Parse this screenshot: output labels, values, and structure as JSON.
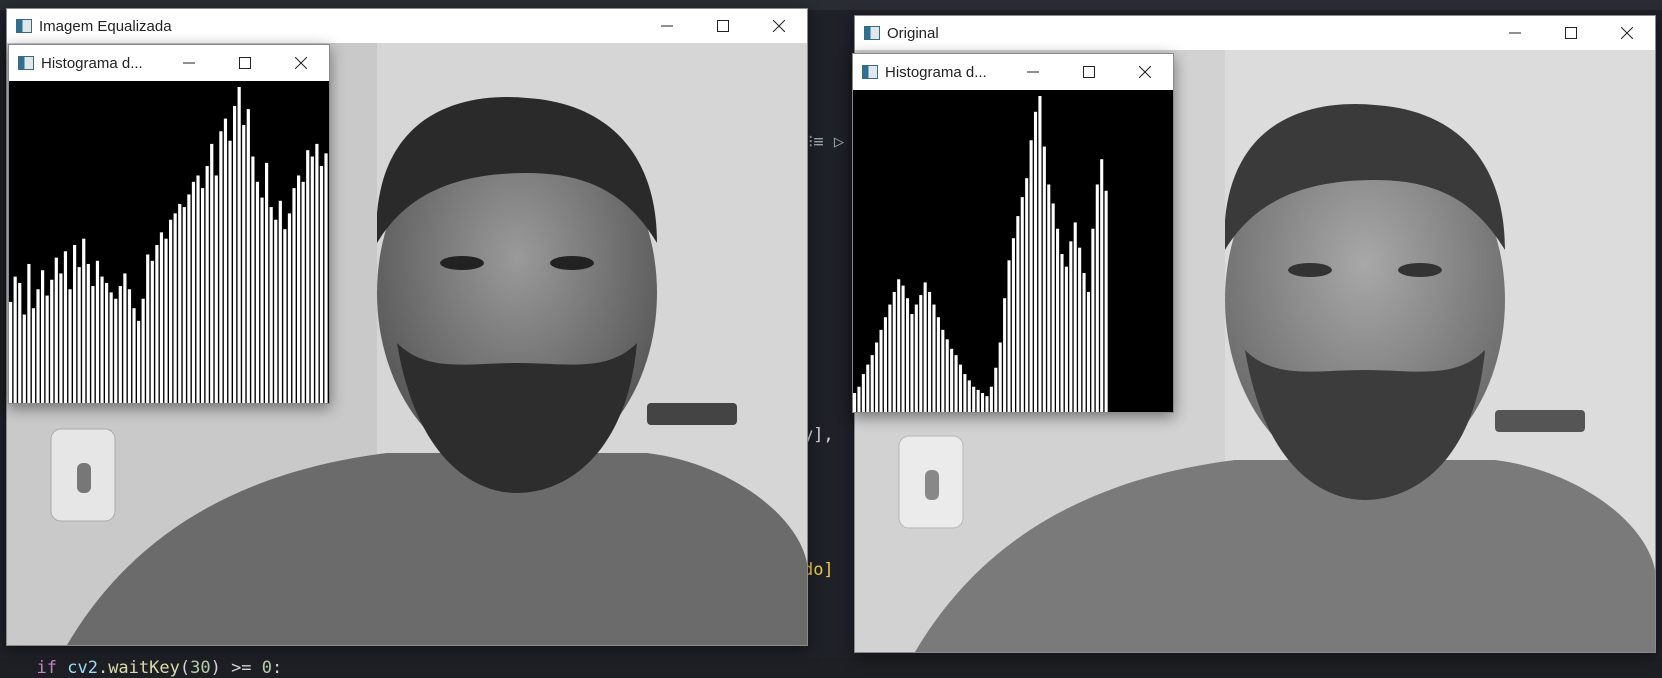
{
  "windows": {
    "equalized": {
      "title": "Imagem Equalizada"
    },
    "equalized_hist": {
      "title": "Histograma d..."
    },
    "original": {
      "title": "Original"
    },
    "original_hist": {
      "title": "Histograma d..."
    }
  },
  "code": {
    "line1_tail": "ray],",
    "line2_tail": "zado]",
    "bottom_line": {
      "kw": "if",
      "obj": "cv2",
      "fn": "waitKey",
      "num": "30",
      "op": ">=",
      "zero": "0",
      "colon": ":"
    }
  },
  "histograms": {
    "equalized_note": "equalized grayscale histogram",
    "equalized_levels": [
      0.32,
      0.4,
      0.38,
      0.28,
      0.44,
      0.3,
      0.36,
      0.42,
      0.34,
      0.39,
      0.46,
      0.41,
      0.48,
      0.36,
      0.5,
      0.43,
      0.52,
      0.44,
      0.37,
      0.45,
      0.4,
      0.38,
      0.35,
      0.33,
      0.37,
      0.41,
      0.36,
      0.3,
      0.26,
      0.33,
      0.47,
      0.45,
      0.5,
      0.54,
      0.52,
      0.58,
      0.6,
      0.63,
      0.62,
      0.66,
      0.7,
      0.72,
      0.68,
      0.75,
      0.82,
      0.72,
      0.86,
      0.9,
      0.83,
      0.94,
      1.0,
      0.88,
      0.93,
      0.78,
      0.7,
      0.65,
      0.76,
      0.62,
      0.58,
      0.64,
      0.55,
      0.6,
      0.68,
      0.72,
      0.7,
      0.8,
      0.78,
      0.82,
      0.75,
      0.79
    ],
    "original_levels": [
      0.06,
      0.08,
      0.12,
      0.15,
      0.18,
      0.22,
      0.26,
      0.3,
      0.34,
      0.38,
      0.42,
      0.4,
      0.36,
      0.31,
      0.34,
      0.37,
      0.41,
      0.38,
      0.34,
      0.3,
      0.26,
      0.23,
      0.2,
      0.18,
      0.15,
      0.12,
      0.1,
      0.08,
      0.07,
      0.06,
      0.05,
      0.08,
      0.14,
      0.22,
      0.36,
      0.48,
      0.55,
      0.62,
      0.68,
      0.74,
      0.86,
      0.95,
      1.0,
      0.84,
      0.72,
      0.66,
      0.58,
      0.5,
      0.46,
      0.54,
      0.6,
      0.52,
      0.44,
      0.38,
      0.58,
      0.72,
      0.8,
      0.7
    ],
    "original_fill_fraction": 0.8
  }
}
